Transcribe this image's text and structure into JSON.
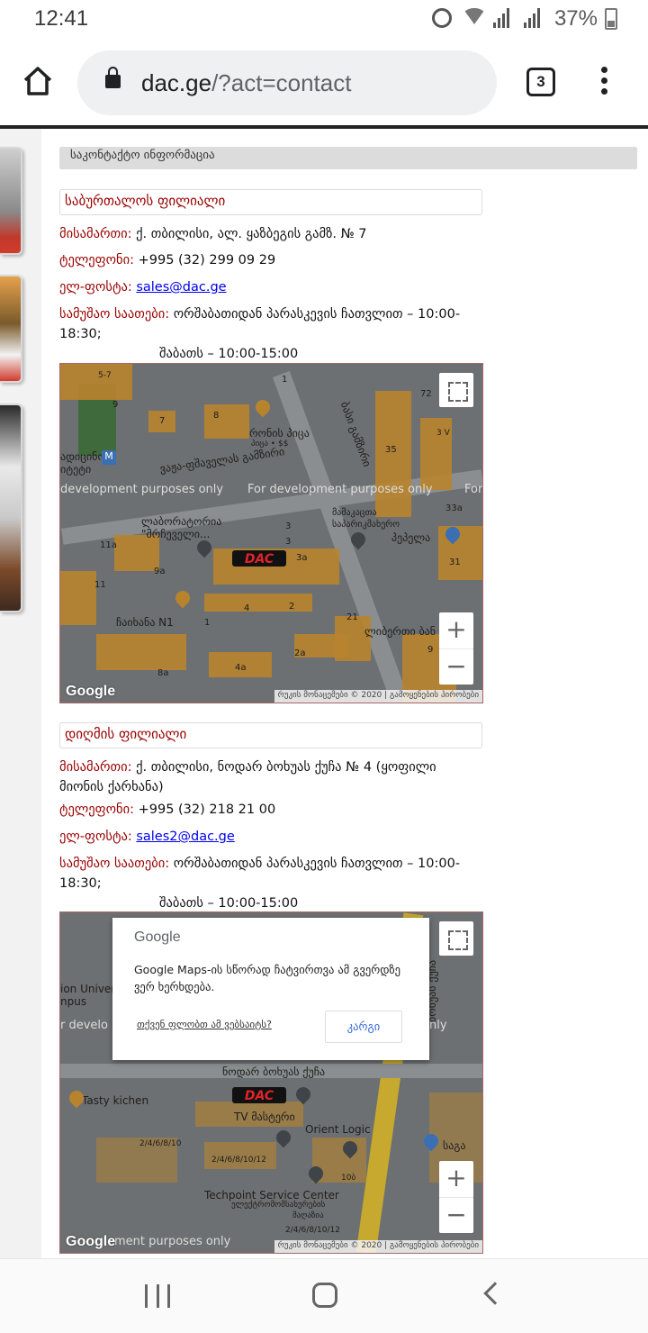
{
  "status": {
    "time": "12:41",
    "battery": "37%",
    "icons": [
      "alarm-icon",
      "wifi-icon",
      "signal-icon",
      "signal-icon",
      "battery-icon"
    ]
  },
  "browser": {
    "url_domain": "dac.ge",
    "url_path": "/?act=contact",
    "tab_count": "3"
  },
  "page": {
    "section_header": "საკონტაქტო ინფორმაცია",
    "branches": [
      {
        "title": "საბურთალოს ფილიალი",
        "address_label": "მისამართი:",
        "address": " ქ. თბილისი, ალ. ყაზბეგის გამზ. № 7",
        "phone_label": "ტელეფონი:",
        "phone": " +995 (32) 299 09 29",
        "email_label": "ელ-ფოსტა:",
        "email": "sales@dac.ge",
        "hours_label": "სამუშაო საათები:",
        "hours_line1": " ორშაბათიდან პარასკევის ჩათვლით – 10:00-18:30;",
        "hours_line2": "შაბათს – 10:00-15:00"
      },
      {
        "title": "დიღმის ფილიალი",
        "address_label": "მისამართი:",
        "address": " ქ. თბილისი, ნოდარ ბოხუას ქუჩა № 4 (ყოფილი მიონის ქარხანა)",
        "phone_label": "ტელეფონი:",
        "phone": " +995 (32) 218 21 00",
        "email_label": "ელ-ფოსტა:",
        "email": "sales2@dac.ge",
        "hours_label": "სამუშაო საათები:",
        "hours_line1": " ორშაბათიდან პარასკევის ჩათვლით – 10:00-18:30;",
        "hours_line2": "შაბათს – 10:00-15:00"
      }
    ],
    "map1": {
      "labels": [
        "რონის პიცა",
        "პიცა • $$",
        "ვაჟა-ფშაველას გამზირი",
        "ლაბორატორია",
        "\"მრჩეველი...",
        "მამაკაცთა",
        "საპარიკმახერო",
        "პეპელა",
        "ჩაიხანა N1",
        "ლიბერთი ბან",
        "ბასი გამზირი",
        "ადიცინო",
        "იტეტი"
      ],
      "numbers": [
        "5-7",
        "9",
        "7",
        "8",
        "1",
        "72",
        "3 V",
        "35",
        "33a",
        "3",
        "3",
        "3a",
        "31",
        "11a",
        "9a",
        "11",
        "4",
        "2",
        "21",
        "9",
        "2a",
        "4a",
        "8a",
        "1"
      ],
      "dev_text": "For development purposes only",
      "dev_left": "development purposes only",
      "dev_right": "For",
      "attrib_data": "რუკის მონაცემები © 2020",
      "attrib_terms": "გამოყენების პირობები",
      "google": "Google"
    },
    "map2": {
      "dialog_title": "Google",
      "dialog_msg": "Google Maps-ის სწორად ჩატვირთვა ამ გვერდზე ვერ ხერხდება.",
      "dialog_own": "თქვენ ფლობთ ამ ვებსაიტს?",
      "dialog_ok": "კარგი",
      "labels": [
        "ion Univers",
        "npus",
        "r develo",
        "nly",
        "ნოდარ ბოხუას ქუჩა",
        "Tasty kichen",
        "TV მასტერი",
        "Orient Logic",
        "საგა",
        "2/4/6/8/10",
        "2/4/6/8/10/12",
        "Techpoint Service Center",
        "ელექტრომომსახურების",
        "მაღაზია",
        "2/4/6/8/10/12",
        "10ბ",
        "ბოხუას ქუჩა",
        "ment purposes only"
      ],
      "attrib_data": "რუკის მონაცემები © 2020",
      "attrib_terms": "გამოყენების პირობები",
      "google": "Google"
    },
    "dac_logo": "DAC"
  },
  "colors": {
    "label_red": "#990000",
    "link_blue": "#0000ee",
    "map_bg": "#6d7072",
    "building": "#b8832d"
  }
}
